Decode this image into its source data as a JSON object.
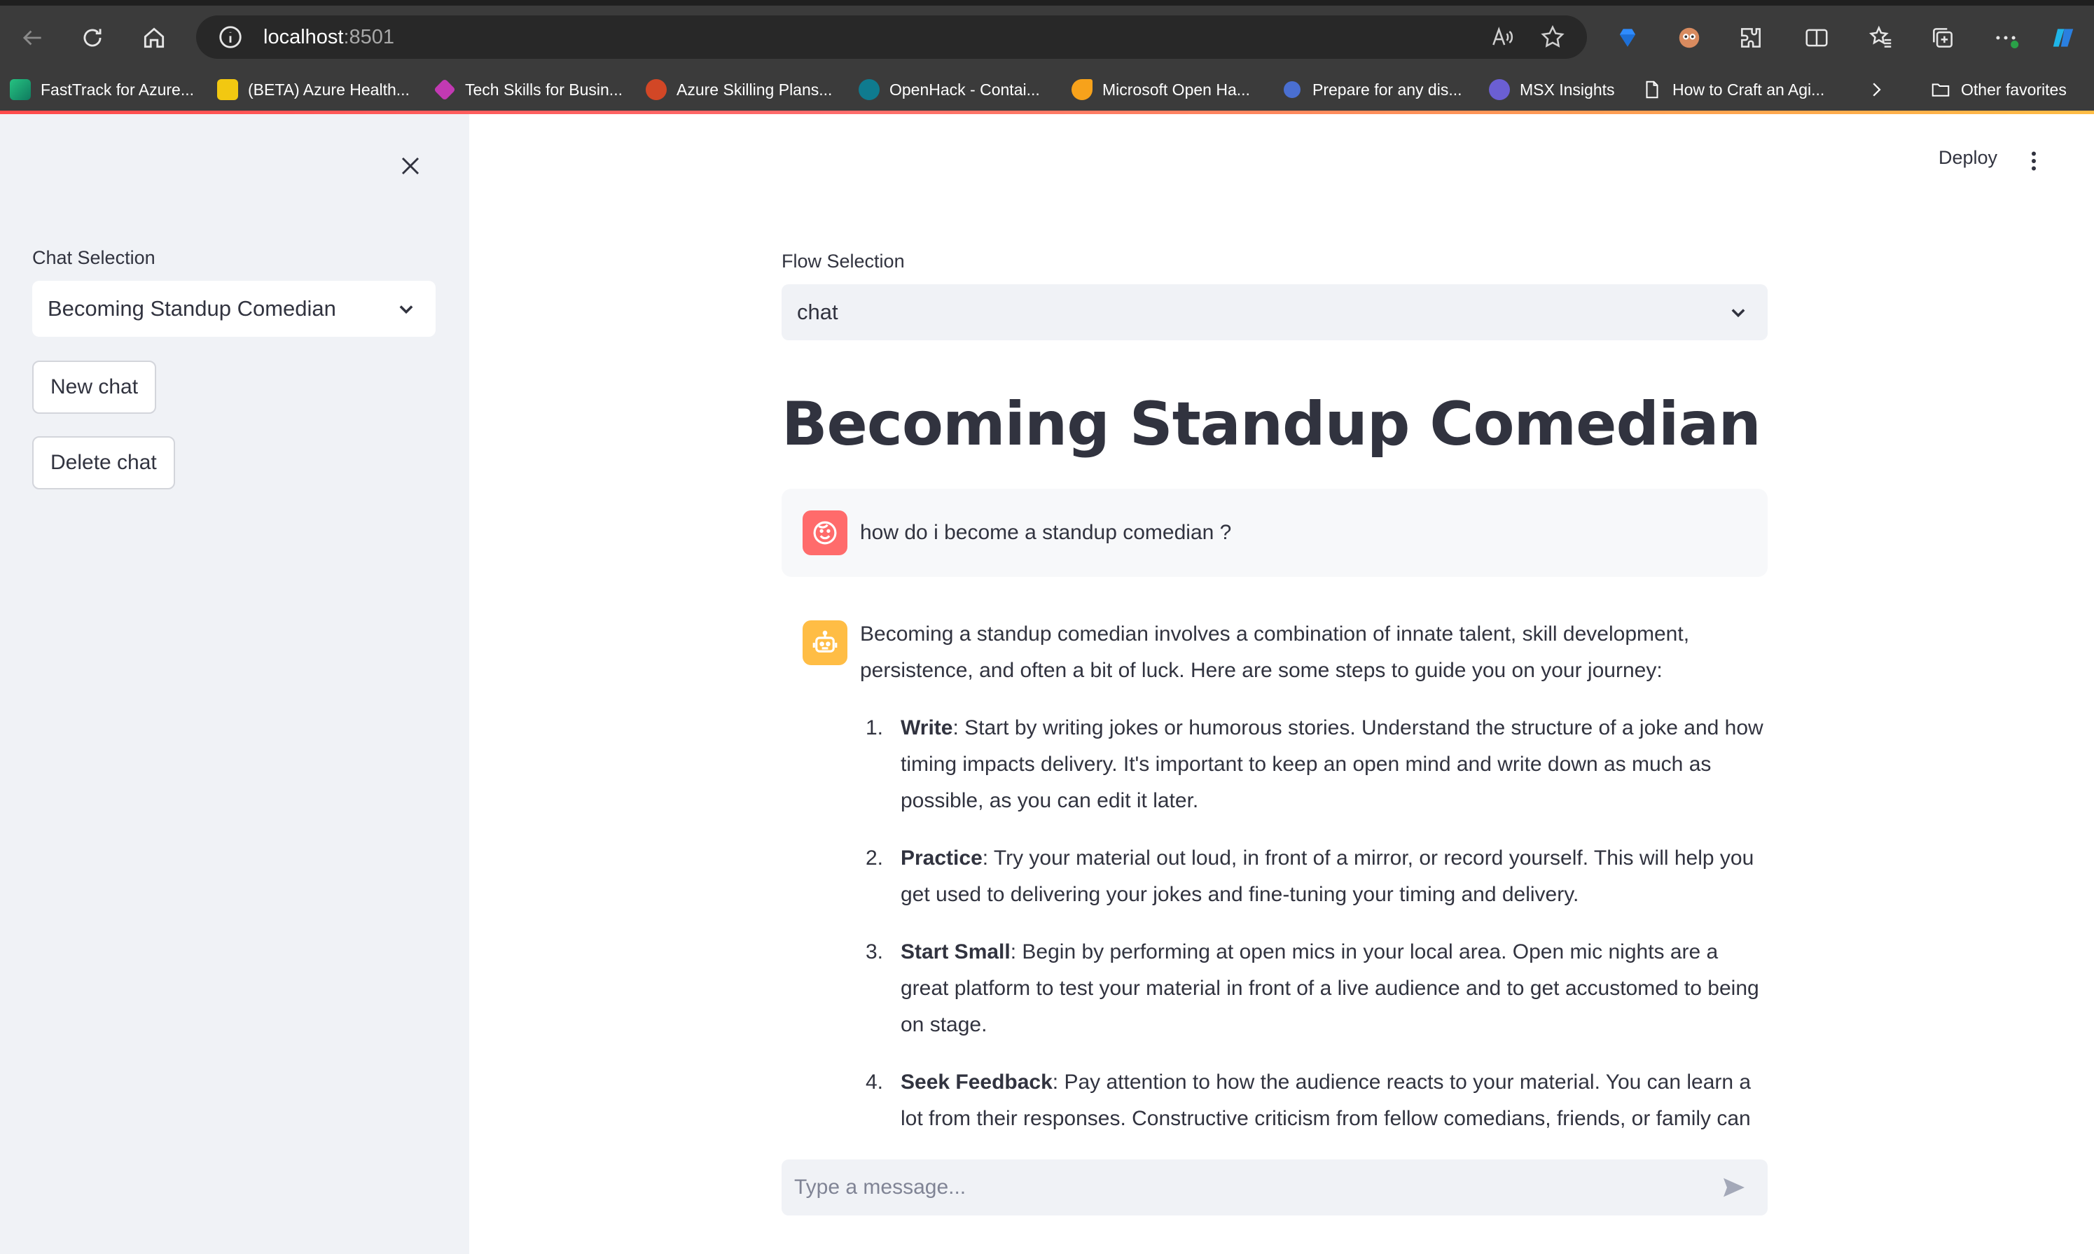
{
  "browser": {
    "url_host": "localhost",
    "url_port": ":8501",
    "bookmarks": [
      {
        "label": "FastTrack for Azure...",
        "color": "#26c281"
      },
      {
        "label": "(BETA) Azure Health...",
        "color": "#f2c811"
      },
      {
        "label": "Tech Skills for Busin...",
        "color": "#c239b3"
      },
      {
        "label": "Azure Skilling Plans...",
        "color": "#d24726"
      },
      {
        "label": "OpenHack - Contai...",
        "color": "#0f7b8f"
      },
      {
        "label": "Microsoft Open Ha...",
        "color": "#f7a21b"
      },
      {
        "label": "Prepare for any dis...",
        "color": "#4a6fd1"
      },
      {
        "label": "MSX Insights",
        "color": "#6b5fd3"
      },
      {
        "label": "How to Craft an Agi...",
        "color": "#ffffff"
      },
      {
        "label": "Other favorites",
        "color": "#ffffff"
      }
    ]
  },
  "sidebar": {
    "chat_selection_label": "Chat Selection",
    "chat_selection_value": "Becoming Standup Comedian",
    "new_chat_label": "New chat",
    "delete_chat_label": "Delete chat"
  },
  "header": {
    "deploy_label": "Deploy"
  },
  "main": {
    "flow_selection_label": "Flow Selection",
    "flow_selection_value": "chat",
    "title": "Becoming Standup Comedian",
    "user_message": "how do i become a standup comedian ?",
    "assistant_intro": "Becoming a standup comedian involves a combination of innate talent, skill development, persistence, and often a bit of luck. Here are some steps to guide you on your journey:",
    "assistant_steps": [
      {
        "num": "1.",
        "title": "Write",
        "text": ": Start by writing jokes or humorous stories. Understand the structure of a joke and how timing impacts delivery. It's important to keep an open mind and write down as much as possible, as you can edit it later."
      },
      {
        "num": "2.",
        "title": "Practice",
        "text": ": Try your material out loud, in front of a mirror, or record yourself. This will help you get used to delivering your jokes and fine-tuning your timing and delivery."
      },
      {
        "num": "3.",
        "title": "Start Small",
        "text": ": Begin by performing at open mics in your local area. Open mic nights are a great platform to test your material in front of a live audience and to get accustomed to being on stage."
      },
      {
        "num": "4.",
        "title": "Seek Feedback",
        "text": ": Pay attention to how the audience reacts to your material. You can learn a lot from their responses. Constructive criticism from fellow comedians, friends, or family can"
      }
    ],
    "chat_input_placeholder": "Type a message..."
  },
  "colors": {
    "accent": "#ff4b4b",
    "user_avatar": "#ff6b6b",
    "assistant_avatar": "#ffbd45",
    "sidebar_bg": "#f0f2f6"
  }
}
